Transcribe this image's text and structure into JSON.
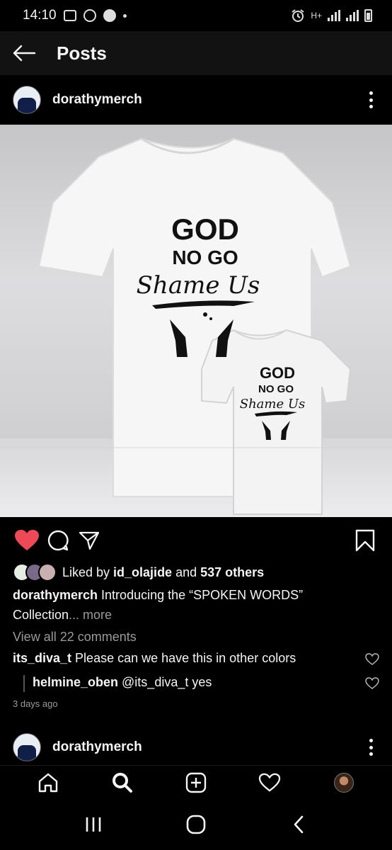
{
  "status_bar": {
    "time": "14:10",
    "icons": [
      "gallery-icon",
      "whatsapp-icon",
      "facebook-icon",
      "dot-icon"
    ],
    "right_icons": [
      "alarm-icon",
      "hplus-data-icon",
      "signal-icon",
      "signal-icon",
      "battery-icon"
    ],
    "data_label": "H+"
  },
  "header": {
    "title": "Posts",
    "back_icon": "arrow-left-icon"
  },
  "post": {
    "username": "dorathymerch",
    "image": {
      "shirt_large_text": [
        "GOD",
        "NO GO",
        "Shame Us"
      ],
      "shirt_small_text": [
        "GOD",
        "NO GO",
        "Shame Us"
      ],
      "background_colors": {
        "top": "#c5c5c7",
        "floor": "#ececee"
      }
    },
    "actions": [
      "heart-filled-icon",
      "comment-icon",
      "share-icon",
      "bookmark-icon"
    ],
    "liked_by_prefix": "Liked by ",
    "liked_by_user": "id_olajide",
    "liked_by_middle": " and ",
    "liked_by_others": "537 others",
    "caption_user": "dorathymerch",
    "caption_text": " Introducing the “SPOKEN WORDS” Collection",
    "caption_more": "... more",
    "view_all_comments": "View all 22 comments",
    "comments": [
      {
        "user": "its_diva_t",
        "text": " Please can we have this in other colors"
      },
      {
        "user": "helmine_oben",
        "text": " @its_diva_t yes"
      }
    ],
    "timestamp": "3 days ago"
  },
  "next_post": {
    "username": "dorathymerch"
  },
  "bottom_nav": [
    "home-icon",
    "search-icon",
    "create-icon",
    "activity-icon",
    "profile-avatar"
  ],
  "android_nav": [
    "recents-icon",
    "home-circle-icon",
    "back-chevron-icon"
  ],
  "colors": {
    "like_red": "#ed4956",
    "muted_text": "#9a9a9a",
    "topbar_bg": "#121212"
  }
}
